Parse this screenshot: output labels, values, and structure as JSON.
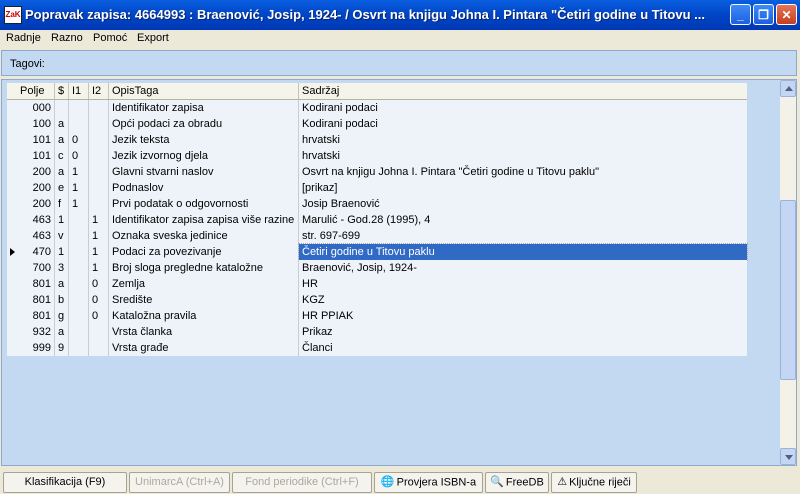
{
  "window": {
    "title": "Popravak zapisa: 4664993 : Braenović, Josip, 1924- / Osvrt na knjigu Johna I. Pintara \"Četiri godine u Titovu ...",
    "app_icon": "ZaK",
    "minimize_label": "_",
    "maximize_label": "❐",
    "close_label": "✕"
  },
  "menu": [
    "Radnje",
    "Razno",
    "Pomoć",
    "Export"
  ],
  "tags_panel": {
    "label": "Tagovi:"
  },
  "table": {
    "headers": [
      "Polje",
      "$",
      "I1",
      "I2",
      "OpisTaga",
      "Sadržaj"
    ],
    "selected_row": 9,
    "rows": [
      [
        "000",
        "",
        "",
        "",
        "Identifikator zapisa",
        "Kodirani podaci"
      ],
      [
        "100",
        "a",
        "",
        "",
        "Opći podaci za obradu",
        "Kodirani podaci"
      ],
      [
        "101",
        "a",
        "0",
        "",
        "Jezik teksta",
        "hrvatski"
      ],
      [
        "101",
        "c",
        "0",
        "",
        "Jezik izvornog djela",
        "hrvatski"
      ],
      [
        "200",
        "a",
        "1",
        "",
        "Glavni stvarni naslov",
        "Osvrt na knjigu Johna I. Pintara \"Četiri godine u Titovu paklu\""
      ],
      [
        "200",
        "e",
        "1",
        "",
        "Podnaslov",
        "[prikaz]"
      ],
      [
        "200",
        "f",
        "1",
        "",
        "Prvi podatak o odgovornosti",
        "Josip Braenović"
      ],
      [
        "463",
        "1",
        "",
        "1",
        "Identifikator zapisa zapisa više razine",
        "Marulić - God.28 (1995), 4"
      ],
      [
        "463",
        "v",
        "",
        "1",
        "Oznaka sveska jedinice",
        "str. 697-699"
      ],
      [
        "470",
        "1",
        "",
        "1",
        "Podaci za povezivanje",
        "Četiri godine u Titovu paklu"
      ],
      [
        "700",
        "3",
        "",
        "1",
        "Broj sloga pregledne kataložne",
        "Braenović, Josip, 1924-"
      ],
      [
        "801",
        "a",
        "",
        "0",
        "Zemlja",
        "HR"
      ],
      [
        "801",
        "b",
        "",
        "0",
        "Središte",
        "KGZ"
      ],
      [
        "801",
        "g",
        "",
        "0",
        "Kataložna pravila",
        "HR PPIAK"
      ],
      [
        "932",
        "a",
        "",
        "",
        "Vrsta članka",
        "Prikaz"
      ],
      [
        "999",
        "9",
        "",
        "",
        "Vrsta građe",
        "Članci"
      ]
    ]
  },
  "toolbar": [
    {
      "label": "Klasifikacija (F9)",
      "enabled": true,
      "icon": ""
    },
    {
      "label": "UnimarcA (Ctrl+A)",
      "enabled": false,
      "icon": ""
    },
    {
      "label": "Fond periodike (Ctrl+F)",
      "enabled": false,
      "icon": ""
    },
    {
      "label": "Provjera  ISBN-a",
      "enabled": true,
      "icon": "globe-icon"
    },
    {
      "label": "FreeDB",
      "enabled": true,
      "icon": "magnifier-icon"
    },
    {
      "label": "Ključne riječi",
      "enabled": true,
      "icon": "warning-icon"
    }
  ]
}
